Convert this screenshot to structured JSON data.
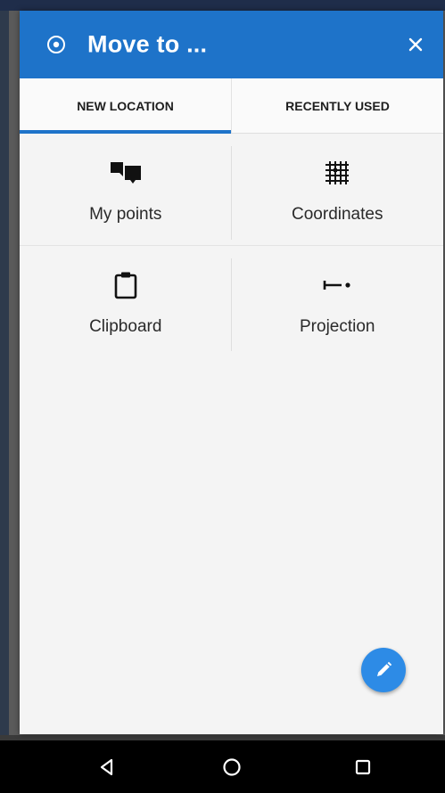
{
  "dialog": {
    "title": "Move to ...",
    "title_icon": "target-icon",
    "close_icon": "close-icon"
  },
  "tabs": [
    {
      "label": "NEW LOCATION",
      "active": true
    },
    {
      "label": "RECENTLY USED",
      "active": false
    }
  ],
  "options": [
    {
      "label": "My points",
      "icon": "points-icon"
    },
    {
      "label": "Coordinates",
      "icon": "grid-icon"
    },
    {
      "label": "Clipboard",
      "icon": "clipboard-icon"
    },
    {
      "label": "Projection",
      "icon": "projection-icon"
    }
  ],
  "fab": {
    "icon": "pencil-icon"
  },
  "navbar": {
    "back_icon": "back-icon",
    "home_icon": "home-icon",
    "recents_icon": "recents-icon"
  },
  "colors": {
    "primary": "#1e73c9",
    "fab": "#2d8be6",
    "background": "#f4f4f4"
  }
}
